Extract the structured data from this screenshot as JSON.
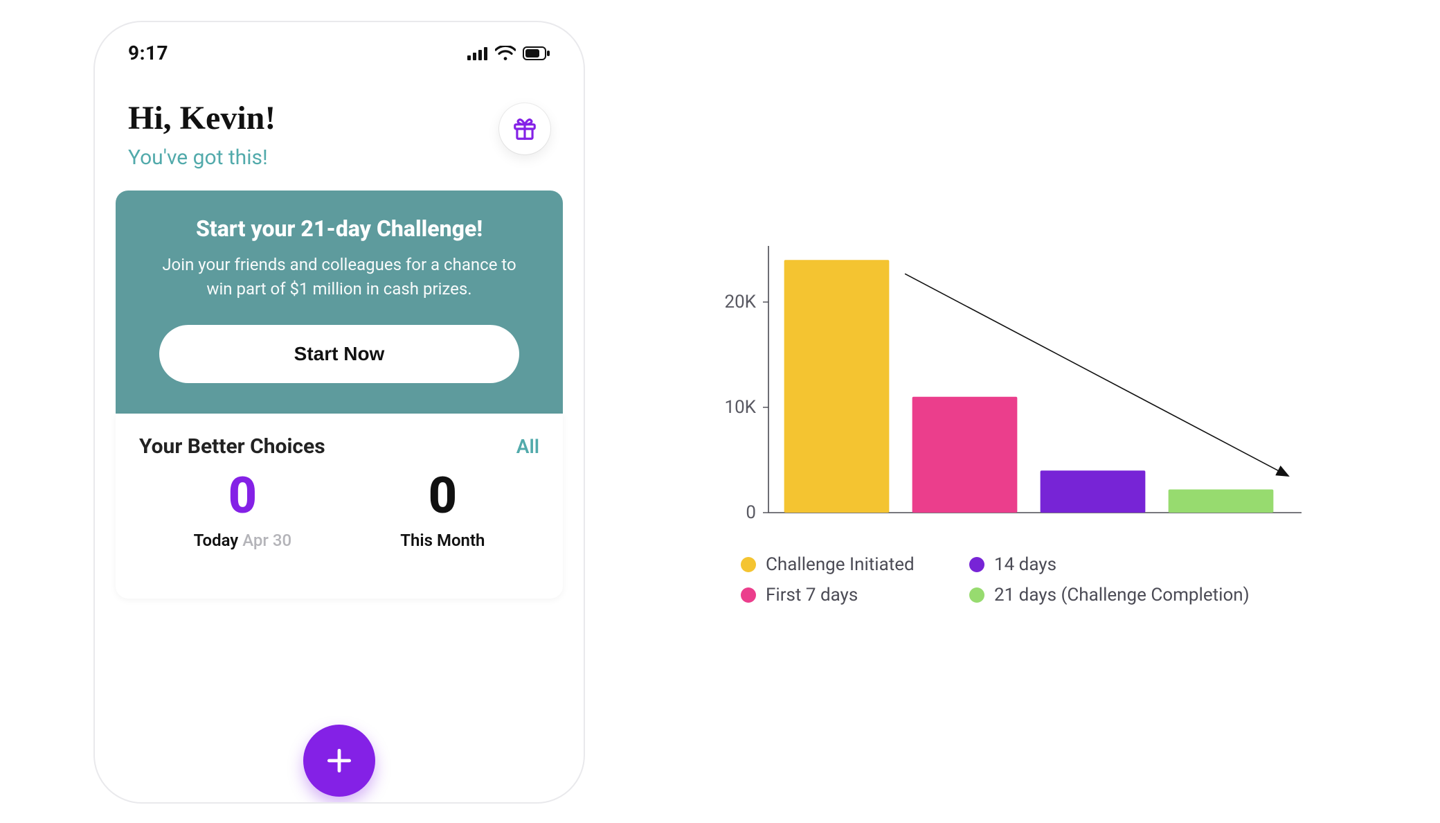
{
  "statusbar": {
    "time": "9:17"
  },
  "greeting": {
    "title": "Hi, Kevin!",
    "subtitle": "You've got this!"
  },
  "challenge": {
    "title": "Start your 21-day Challenge!",
    "body": "Join your friends and colleagues for a chance to win part of $1 million in cash prizes.",
    "cta": "Start Now"
  },
  "choices": {
    "header": "Your Better Choices",
    "all_link": "All",
    "today_value": "0",
    "today_label": "Today",
    "today_date": "Apr 30",
    "month_value": "0",
    "month_label": "This Month"
  },
  "colors": {
    "teal": "#5e9b9d",
    "teal_text": "#52aaab",
    "purple": "#8421e6",
    "yellow": "#f4c431",
    "pink": "#eb3e8c",
    "violet": "#7724d6",
    "green": "#97db6f",
    "axis_text": "#595962"
  },
  "chart_data": {
    "type": "bar",
    "categories": [
      "Challenge Initiated",
      "First 7 days",
      "14 days",
      "21 days (Challenge Completion)"
    ],
    "values": [
      24000,
      11000,
      4000,
      2200
    ],
    "series_colors": [
      "#f4c431",
      "#eb3e8c",
      "#7724d6",
      "#97db6f"
    ],
    "ylabel": "",
    "xlabel": "",
    "yticks": [
      0,
      10000,
      20000
    ],
    "ytick_labels": [
      "0",
      "10K",
      "20K"
    ],
    "ylim": [
      0,
      25000
    ],
    "annotations": {
      "trend_arrow": {
        "from": [
          0,
          24000
        ],
        "to": [
          3,
          2200
        ]
      }
    }
  }
}
